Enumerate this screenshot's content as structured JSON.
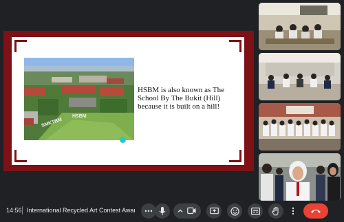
{
  "slide": {
    "text": "HSBM is also known as The School By The Bukit (Hill) because it is built on a hill!",
    "photo": {
      "sign_left": "SMKTBM",
      "sign_right": "HSBM"
    }
  },
  "participants": [
    {
      "name": "",
      "scene": "classroom-students-seated"
    },
    {
      "name": "",
      "scene": "hall-group-front-row"
    },
    {
      "name": "",
      "scene": "students-in-white-rows"
    },
    {
      "name": "",
      "scene": "student-in-hijab-closeup"
    }
  ],
  "bottom_bar": {
    "time": "14:56",
    "meeting_title": "International Recycled Art Contest Award..."
  },
  "controls": [
    {
      "name": "more-dots-button",
      "icon": "more-horizontal-icon"
    },
    {
      "name": "microphone-button",
      "icon": "microphone-icon"
    },
    {
      "name": "camera-button",
      "icon": "camera-icon"
    },
    {
      "name": "present-screen-button",
      "icon": "present-icon"
    },
    {
      "name": "emoji-reaction-button",
      "icon": "emoji-icon"
    },
    {
      "name": "captions-button",
      "icon": "captions-icon"
    },
    {
      "name": "raise-hand-button",
      "icon": "hand-icon"
    },
    {
      "name": "more-options-button",
      "icon": "more-vertical-icon"
    },
    {
      "name": "leave-call-button",
      "icon": "phone-hangup-icon"
    }
  ],
  "colors": {
    "background": "#202124",
    "slide_border": "#7e1116",
    "control_bg": "#3c4043",
    "end_call": "#ea4335",
    "cursor_dot": "#2bc7c1"
  }
}
